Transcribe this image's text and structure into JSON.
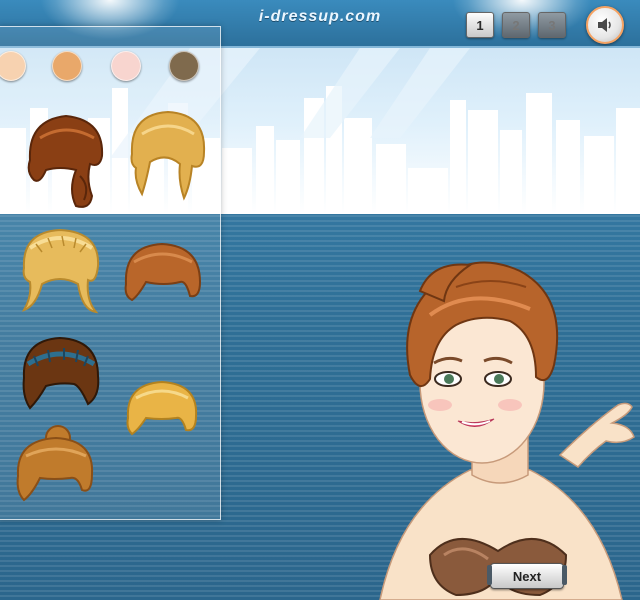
{
  "header": {
    "site_url": "i-dressup.com",
    "pages": [
      "1",
      "2",
      "3"
    ],
    "active_page": "1",
    "sound_icon": "speaker-icon"
  },
  "palette": {
    "skin_tones": [
      "#f7d2b0",
      "#e9a86a",
      "#f8d5cf",
      "#7f6a4d"
    ],
    "accent": "#f6a261"
  },
  "wardrobe": {
    "hairstyles": [
      {
        "id": "hair-1",
        "color": "#8a3f14",
        "shade": "#5a260a"
      },
      {
        "id": "hair-2",
        "color": "#e2b04f",
        "shade": "#b88325"
      },
      {
        "id": "hair-3",
        "color": "#e7bb5c",
        "shade": "#b98a2d"
      },
      {
        "id": "hair-4",
        "color": "#b9662a",
        "shade": "#7c3f14"
      },
      {
        "id": "hair-5",
        "color": "#6b3612",
        "shade": "#2f1808",
        "ribbon": "#2e6f8f"
      },
      {
        "id": "hair-6",
        "color": "#e9b446",
        "shade": "#b3821f"
      },
      {
        "id": "hair-7",
        "color": "#c07b2c",
        "shade": "#8a4f17"
      }
    ]
  },
  "model": {
    "hair_color": "#b7642b",
    "skin": "#f9e2c8",
    "top_color": "#8a5a3c"
  },
  "buttons": {
    "next_label": "Next"
  }
}
